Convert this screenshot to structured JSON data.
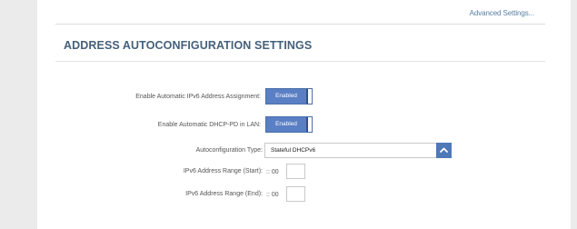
{
  "header": {
    "advanced_settings_link": "Advanced Settings..."
  },
  "section": {
    "title": "ADDRESS AUTOCONFIGURATION SETTINGS"
  },
  "fields": {
    "auto_ipv6_assignment": {
      "label": "Enable Automatic IPv6 Address Assignment:",
      "value": "Enabled"
    },
    "auto_dhcp_pd": {
      "label": "Enable Automatic DHCP-PD in LAN:",
      "value": "Enabled"
    },
    "autoconfig_type": {
      "label": "Autoconfiguration Type:",
      "selected": "Stateful DHCPv6"
    },
    "range_start": {
      "label": "IPv6 Address Range (Start):",
      "prefix": ":: 00",
      "value": ""
    },
    "range_end": {
      "label": "IPv6 Address Range (End):",
      "prefix": ":: 00",
      "value": ""
    }
  },
  "colors": {
    "accent": "#5b7fc4",
    "title": "#46607a",
    "link": "#5a7fa3"
  },
  "icons": {
    "dropdown": "chevron-up-icon"
  }
}
